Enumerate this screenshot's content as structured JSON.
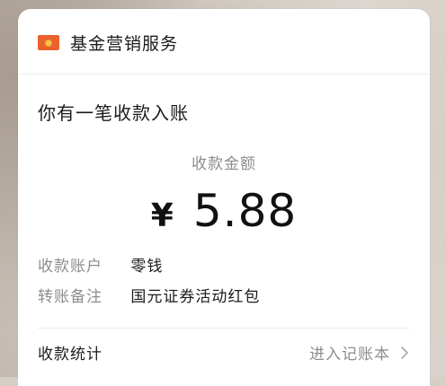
{
  "header": {
    "brand_icon": "red-envelope-icon",
    "brand_name": "基金营销服务"
  },
  "notice": "你有一笔收款入账",
  "amount": {
    "label": "收款金额",
    "currency": "¥",
    "value": "5.88"
  },
  "details": [
    {
      "label": "收款账户",
      "value": "零钱"
    },
    {
      "label": "转账备注",
      "value": "国元证券活动红包"
    }
  ],
  "footer": {
    "stats_label": "收款统计",
    "enter_label": "进入记账本",
    "chevron_icon": "chevron-right-icon"
  },
  "colors": {
    "brand_icon": "#e9612c",
    "secondary_text": "#8d8d8d",
    "primary_text": "#1b1b1b"
  }
}
